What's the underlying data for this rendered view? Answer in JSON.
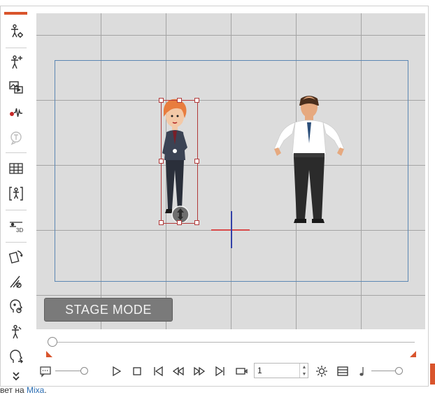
{
  "stage": {
    "mode_button": "STAGE MODE"
  },
  "transport": {
    "frame_value": "1"
  },
  "footer": {
    "prefix": "вет на ",
    "link": "Mixa",
    "suffix": "."
  },
  "colors": {
    "accent": "#d9542c",
    "stage_bg": "#dcdcdc",
    "frame_border": "#5c87b3"
  },
  "toolbar_icons": [
    "actor-settings-icon",
    "actor-sparkle-icon",
    "media-scene-icon",
    "audio-record-icon",
    "text-balloon-icon",
    "grid-layout-icon",
    "actor-frame-icon",
    "3d-layer-icon",
    "rotate-flip-icon",
    "motion-brush-icon",
    "face-puppet-icon",
    "body-puppet-icon",
    "head-turn-icon",
    "more-chevron-icon"
  ]
}
